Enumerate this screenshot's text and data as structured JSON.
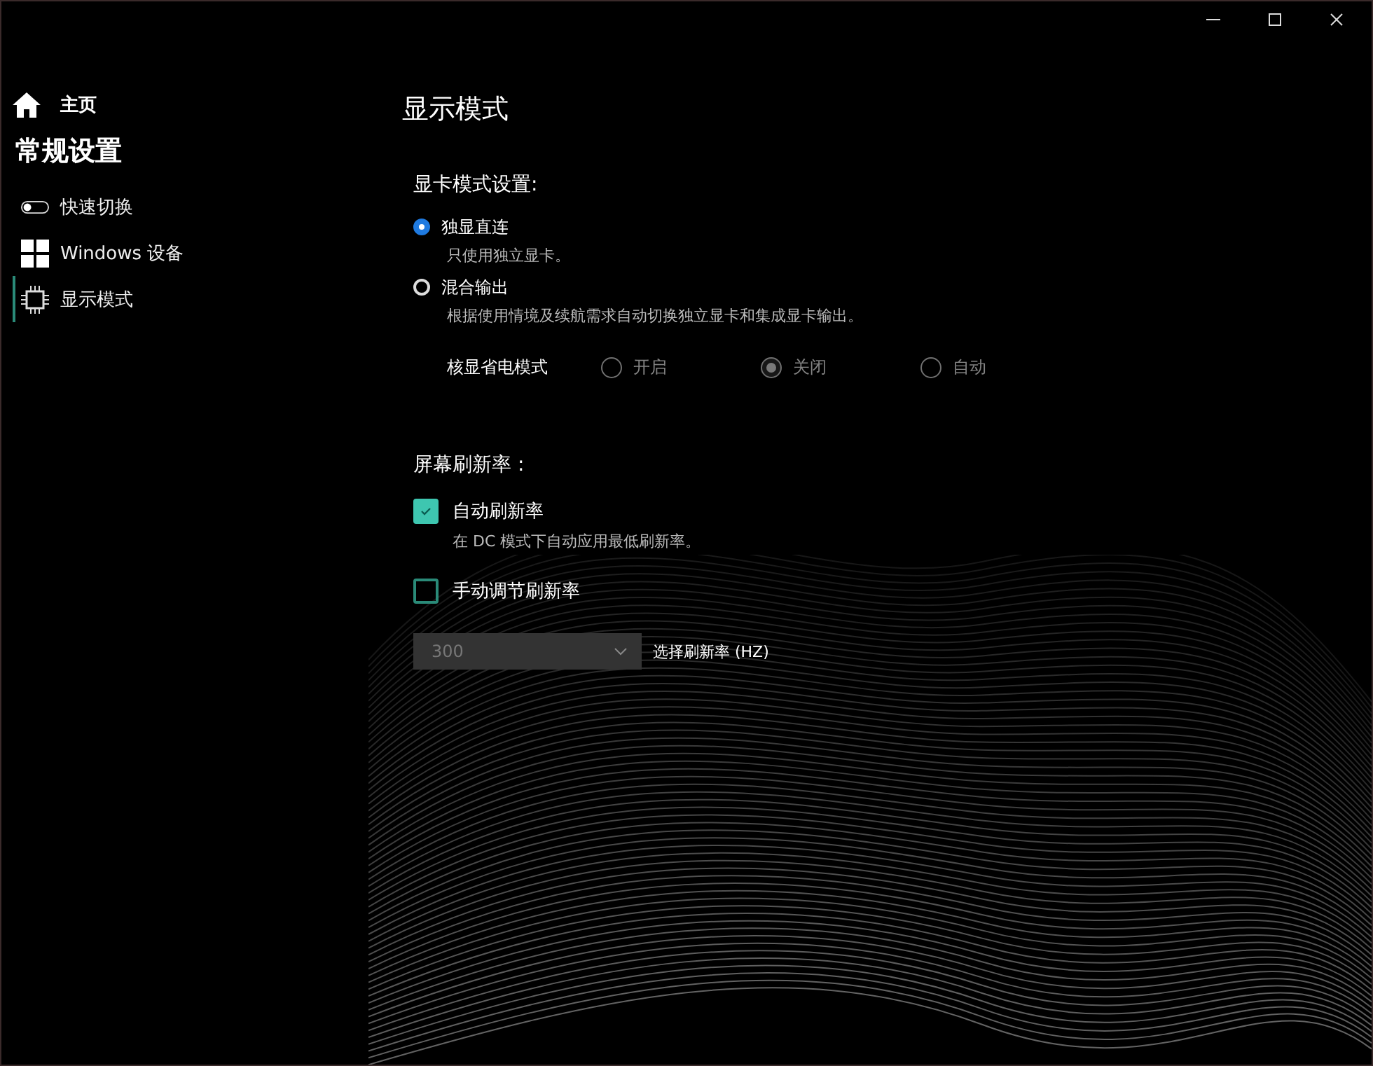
{
  "sidebar": {
    "home": {
      "label": "主页"
    },
    "heading": "常规设置",
    "items": [
      {
        "label": "快速切换",
        "kind": "toggle",
        "selected": false
      },
      {
        "label": "Windows 设备",
        "kind": "windows",
        "selected": false
      },
      {
        "label": "显示模式",
        "kind": "chip",
        "selected": true
      }
    ]
  },
  "page": {
    "title": "显示模式",
    "gpu_section": {
      "heading": "显卡模式设置:",
      "options": [
        {
          "label": "独显直连",
          "description": "只使用独立显卡。",
          "selected": true
        },
        {
          "label": "混合输出",
          "description": "根据使用情境及续航需求自动切换独立显卡和集成显卡输出。",
          "selected": false
        }
      ],
      "power_saving": {
        "label": "核显省电模式",
        "disabled": true,
        "options": [
          {
            "label": "开启",
            "selected": false
          },
          {
            "label": "关闭",
            "selected": true
          },
          {
            "label": "自动",
            "selected": false
          }
        ]
      }
    },
    "refresh_section": {
      "heading": "屏幕刷新率 :",
      "options": [
        {
          "label": "自动刷新率",
          "description": "在 DC 模式下自动应用最低刷新率。",
          "checked": true
        },
        {
          "label": "手动调节刷新率",
          "checked": false
        }
      ],
      "dropdown": {
        "value": "300",
        "disabled": true,
        "label": "选择刷新率 (HZ)"
      }
    }
  }
}
